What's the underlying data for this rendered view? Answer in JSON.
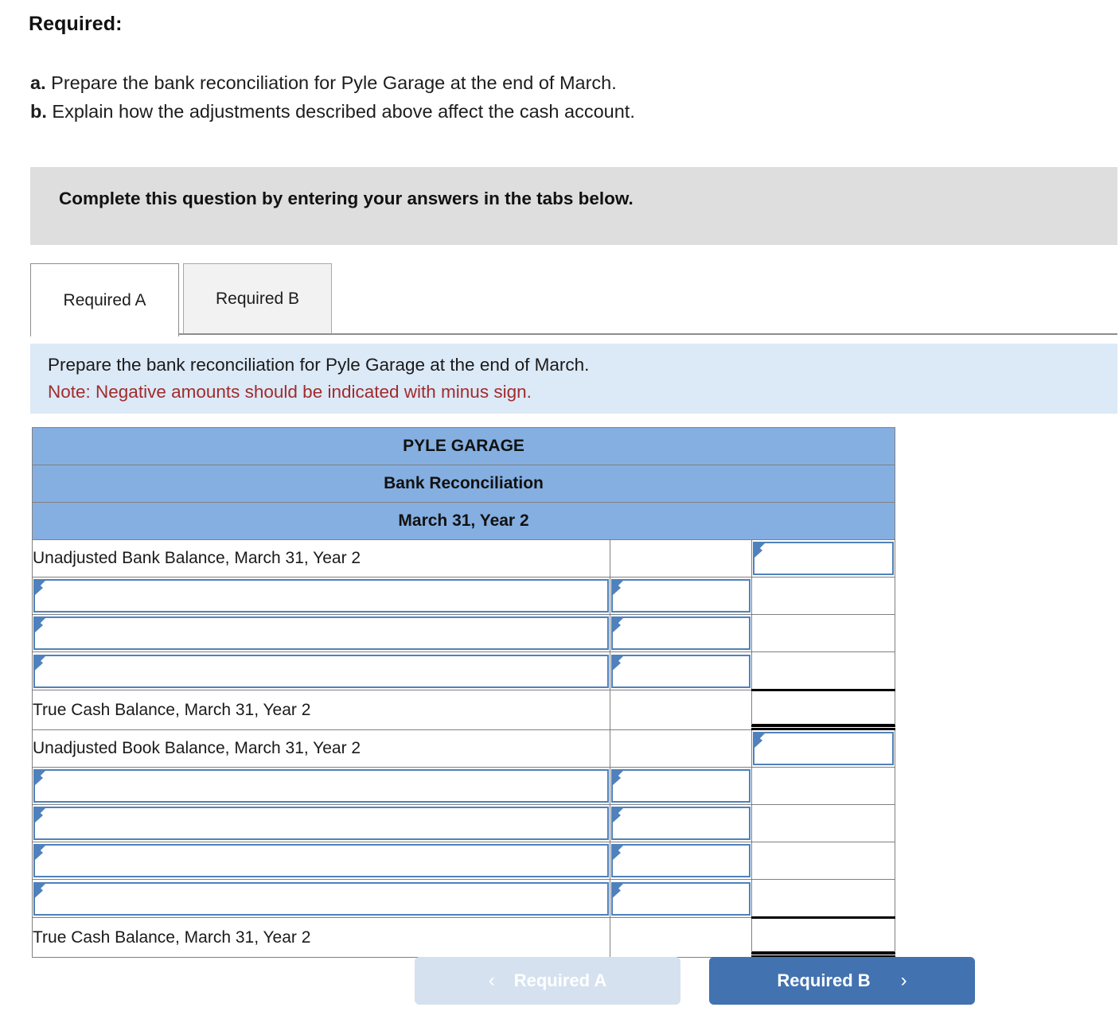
{
  "required": {
    "heading": "Required:",
    "items": [
      {
        "label": "a.",
        "text": "Prepare the bank reconciliation for Pyle Garage at the end of March."
      },
      {
        "label": "b.",
        "text": "Explain how the adjustments described above affect the cash account."
      }
    ]
  },
  "complete_bar": {
    "text": "Complete this question by entering your answers in the tabs below."
  },
  "tabs": [
    {
      "label": "Required A",
      "active": true
    },
    {
      "label": "Required B",
      "active": false
    }
  ],
  "note_panel": {
    "instruction": "Prepare the bank reconciliation for Pyle Garage at the end of March.",
    "note": "Note: Negative amounts should be indicated with minus sign.",
    "note_color": "#a02c2c",
    "background": "#dce9f7"
  },
  "worksheet": {
    "header_color": "#85afe1",
    "input_border_color": "#4e81bd",
    "headers": [
      "PYLE GARAGE",
      "Bank Reconciliation",
      "March 31, Year 2"
    ],
    "rows": [
      {
        "type": "label",
        "desc": "Unadjusted Bank Balance, March 31, Year 2",
        "mid": "",
        "amt": "",
        "amt_input": true,
        "desc_input": false,
        "mid_input": false
      },
      {
        "type": "input",
        "desc": "",
        "mid": "",
        "amt": "",
        "amt_input": false,
        "desc_input": true,
        "mid_input": true
      },
      {
        "type": "input",
        "desc": "",
        "mid": "",
        "amt": "",
        "amt_input": false,
        "desc_input": true,
        "mid_input": true
      },
      {
        "type": "input",
        "desc": "",
        "mid": "",
        "amt": "",
        "amt_input": false,
        "desc_input": true,
        "mid_input": true
      },
      {
        "type": "total",
        "desc": "True Cash Balance, March 31, Year 2",
        "mid": "",
        "amt": "",
        "amt_input": false,
        "desc_input": false,
        "mid_input": false
      },
      {
        "type": "label",
        "desc": "Unadjusted Book Balance, March 31, Year 2",
        "mid": "",
        "amt": "",
        "amt_input": true,
        "desc_input": false,
        "mid_input": false
      },
      {
        "type": "input",
        "desc": "",
        "mid": "",
        "amt": "",
        "amt_input": false,
        "desc_input": true,
        "mid_input": true
      },
      {
        "type": "input",
        "desc": "",
        "mid": "",
        "amt": "",
        "amt_input": false,
        "desc_input": true,
        "mid_input": true
      },
      {
        "type": "input",
        "desc": "",
        "mid": "",
        "amt": "",
        "amt_input": false,
        "desc_input": true,
        "mid_input": true
      },
      {
        "type": "input",
        "desc": "",
        "mid": "",
        "amt": "",
        "amt_input": false,
        "desc_input": true,
        "mid_input": true
      },
      {
        "type": "total",
        "desc": "True Cash Balance, March 31, Year 2",
        "mid": "",
        "amt": "",
        "amt_input": false,
        "desc_input": false,
        "mid_input": false
      }
    ]
  },
  "nav": {
    "prev_label": "Required A",
    "prev_icon": "chevron-left-icon",
    "prev_glyph": "‹",
    "next_label": "Required B",
    "next_icon": "chevron-right-icon",
    "next_glyph": "›",
    "next_color": "#4272b0",
    "prev_color": "#d6e1ef"
  }
}
